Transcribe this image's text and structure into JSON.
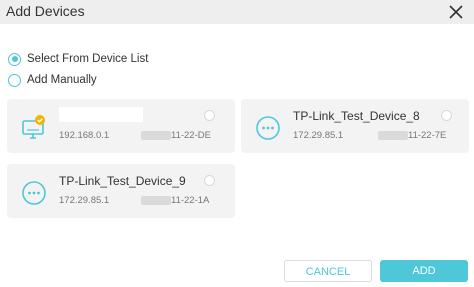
{
  "dialog": {
    "title": "Add Devices"
  },
  "mode": {
    "options": [
      {
        "label": "Select From Device List",
        "selected": true
      },
      {
        "label": "Add Manually",
        "selected": false
      }
    ]
  },
  "devices": [
    {
      "name": "",
      "ip": "192.168.0.1",
      "mac_suffix": "11-22-DE",
      "icon": "monitor-icon"
    },
    {
      "name": "TP-Link_Test_Device_8",
      "ip": "172.29.85.1",
      "mac_suffix": "11-22-7E",
      "icon": "more-icon"
    },
    {
      "name": "TP-Link_Test_Device_9",
      "ip": "172.29.85.1",
      "mac_suffix": "11-22-1A",
      "icon": "more-icon"
    }
  ],
  "buttons": {
    "cancel": "CANCEL",
    "add": "ADD"
  },
  "colors": {
    "accent": "#4ec7d8",
    "card_bg": "#f3f3f3",
    "badge": "#f5b400"
  }
}
